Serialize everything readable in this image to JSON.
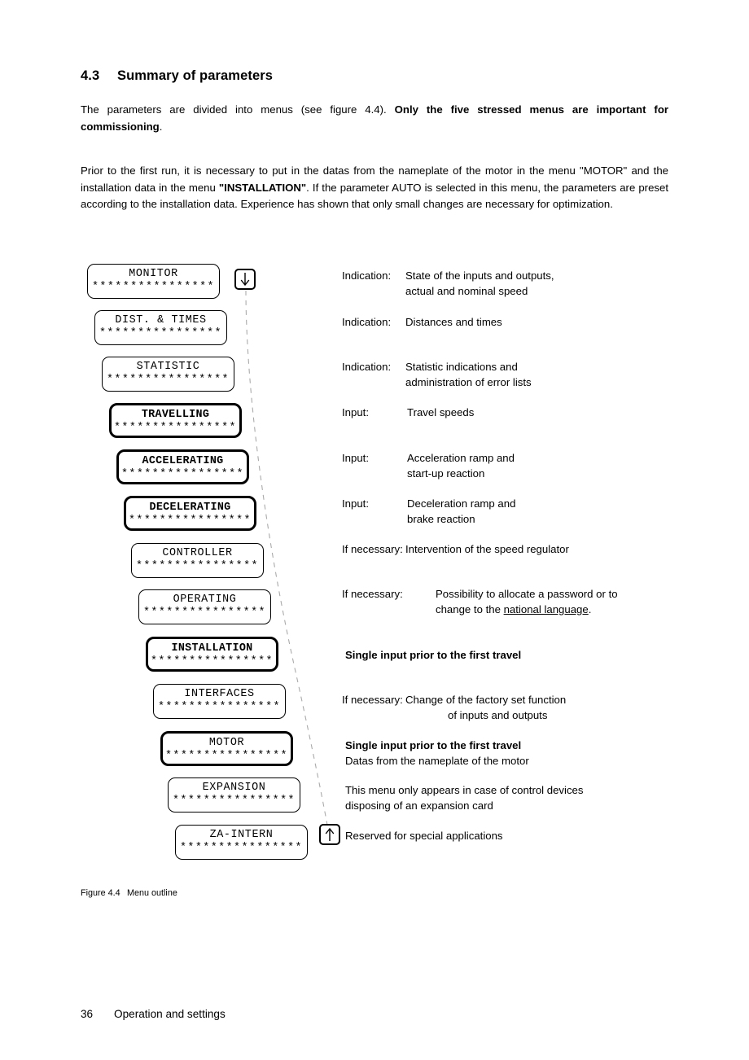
{
  "heading": {
    "number": "4.3",
    "title": "Summary of parameters"
  },
  "paragraphs": {
    "p1_a": "The parameters are divided into menus (see figure 4.4). ",
    "p1_b": "Only the five stressed menus are important for commissioning",
    "p1_c": ".",
    "p2_a": "Prior to the first run, it is necessary to put in the datas from the nameplate of the motor in the menu \"MOTOR\" and the installation data in the menu ",
    "p2_b": "\"INSTALLATION\"",
    "p2_c": ". If the parameter AUTO is selected in this menu, the parameters are preset according to the installation data. Experience has shown that only small changes are necessary for optimization."
  },
  "figure": {
    "stars": "****************",
    "arrow_down_name": "arrow-down-icon",
    "arrow_up_name": "arrow-up-icon",
    "menus": [
      {
        "label": "MONITOR",
        "stressed": false,
        "bold_title": false
      },
      {
        "label": "DIST. & TIMES",
        "stressed": false,
        "bold_title": false
      },
      {
        "label": "STATISTIC",
        "stressed": false,
        "bold_title": false
      },
      {
        "label": "TRAVELLING",
        "stressed": true,
        "bold_title": true
      },
      {
        "label": "ACCELERATING",
        "stressed": true,
        "bold_title": true
      },
      {
        "label": "DECELERATING",
        "stressed": true,
        "bold_title": true
      },
      {
        "label": "CONTROLLER",
        "stressed": false,
        "bold_title": false
      },
      {
        "label": "OPERATING",
        "stressed": false,
        "bold_title": false
      },
      {
        "label": "INSTALLATION",
        "stressed": true,
        "bold_title": true
      },
      {
        "label": "INTERFACES",
        "stressed": false,
        "bold_title": false
      },
      {
        "label": "MOTOR",
        "stressed": true,
        "bold_title": false
      },
      {
        "label": "EXPANSION",
        "stressed": false,
        "bold_title": false
      },
      {
        "label": "ZA-INTERN",
        "stressed": false,
        "bold_title": false
      }
    ],
    "descriptions": [
      {
        "label": "Indication:",
        "line1": "State of the inputs and outputs,",
        "line2": "actual and nominal speed"
      },
      {
        "label": "Indication:",
        "line1": "Distances and times",
        "line2": ""
      },
      {
        "label": "Indication:",
        "line1": "Statistic indications and",
        "line2": "administration of error lists"
      },
      {
        "label": "Input:",
        "line1": "Travel speeds",
        "line2": ""
      },
      {
        "label": "Input:",
        "line1": "Acceleration ramp and",
        "line2": "start-up reaction"
      },
      {
        "label": "Input:",
        "line1": "Deceleration ramp and",
        "line2": "brake reaction"
      },
      {
        "label": "If necessary:",
        "line1": "Intervention of the speed regulator",
        "line2": ""
      },
      {
        "label": "If necessary:",
        "line1": "Possibility to allocate a password or to",
        "line2_pre": "change to the ",
        "line2_underline": "national language",
        "line2_post": "."
      },
      {
        "label": "",
        "line1": "Single input prior to the first travel",
        "line2": ""
      },
      {
        "label": "If necessary:",
        "line1": "Change of the factory set function",
        "line2": "of inputs and outputs"
      },
      {
        "label": "",
        "line1": "Single input prior to the first travel",
        "line2": "Datas from the nameplate of the motor"
      },
      {
        "label": "",
        "line1": "This menu only appears in case of control devices",
        "line2": "disposing of an expansion card"
      },
      {
        "label": "",
        "line1": "Reserved for special applications",
        "line2": ""
      }
    ]
  },
  "caption": {
    "number": "Figure 4.4",
    "text": "Menu outline"
  },
  "footer": {
    "page": "36",
    "text": "Operation and settings"
  },
  "colors": {
    "text": "#000000",
    "connector": "#aaaaaa",
    "background": "#ffffff"
  }
}
